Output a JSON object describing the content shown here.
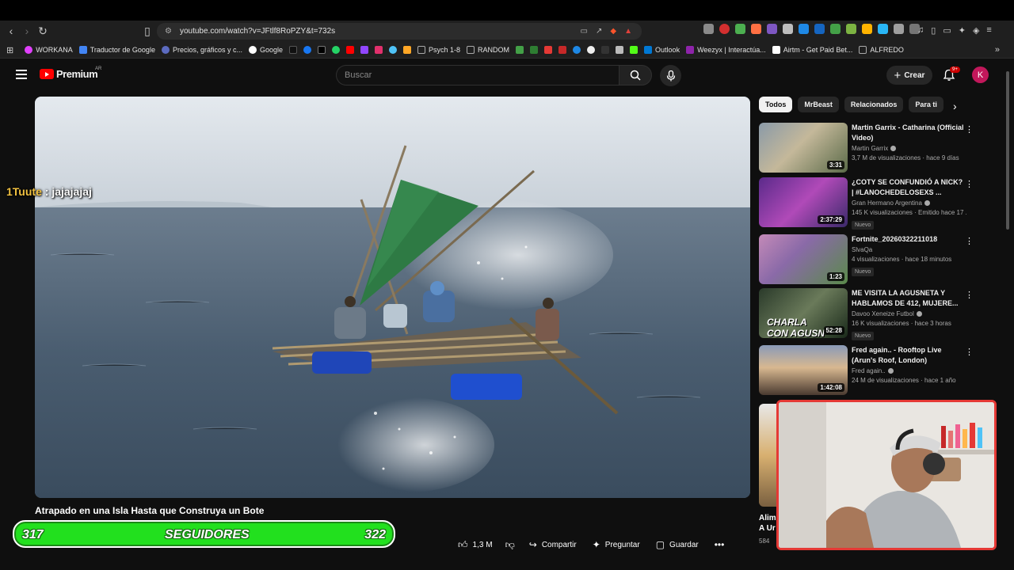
{
  "browser": {
    "url": "youtube.com/watch?v=JFtlf8RoPZY&t=732s",
    "bookmarks": [
      "WORKANA",
      "Traductor de Google",
      "Precios, gráficos y c...",
      "Google",
      "Psych 1-8",
      "RANDOM",
      "Outlook",
      "Weezyx | Interactúa...",
      "Airtm - Get Paid Bet...",
      "ALFREDO"
    ]
  },
  "header": {
    "brand": "Premium",
    "country": "AR",
    "search_placeholder": "Buscar",
    "create_label": "Crear",
    "notifications_count": "9+",
    "avatar_letter": "K"
  },
  "video": {
    "title": "Atrapado en una Isla Hasta que Construya un Bote",
    "chat_user": "1Tuute",
    "chat_sep": " : ",
    "chat_message": "jajajajaj",
    "likes": "1,3 M",
    "share_label": "Compartir",
    "ask_label": "Preguntar",
    "save_label": "Guardar"
  },
  "followers_overlay": {
    "current": "317",
    "label": "SEGUIDORES",
    "goal": "322"
  },
  "sidebar": {
    "chips": [
      "Todos",
      "MrBeast",
      "Relacionados",
      "Para ti"
    ],
    "recommendations": [
      {
        "title": "Martin Garrix - Catharina (Official Video)",
        "channel": "Martin Garrix",
        "meta": "3,7 M de visualizaciones · hace 9 días",
        "duration": "3:31",
        "badge": ""
      },
      {
        "title": "¿COTY SE CONFUNDIÓ A NICK? | #LANOCHEDELOSEXS ...",
        "channel": "Gran Hermano Argentina",
        "meta": "145 K visualizaciones · Emitido hace 17 ...",
        "duration": "2:37:29",
        "badge": "Nuevo"
      },
      {
        "title": "Fortnite_20260322211018",
        "channel": "SlvaQa",
        "meta": "4 visualizaciones · hace 18 minutos",
        "duration": "1:23",
        "badge": "Nuevo"
      },
      {
        "title": "ME VISITA LA AGUSNETA Y HABLAMOS DE 412, MUJERE...",
        "channel": "Davoo Xeneize Futbol",
        "meta": "16 K visualizaciones · hace 3 horas",
        "duration": "52:28",
        "badge": "Nuevo"
      },
      {
        "title": "Fred again.. - Rooftop Live (Arun's Roof, London)",
        "channel": "Fred again..",
        "meta": "24 M de visualizaciones · hace 1 año",
        "duration": "1:42:08",
        "badge": ""
      }
    ],
    "partial_title_1": "Alim",
    "partial_title_2": "A Ur",
    "partial_meta": "584"
  }
}
